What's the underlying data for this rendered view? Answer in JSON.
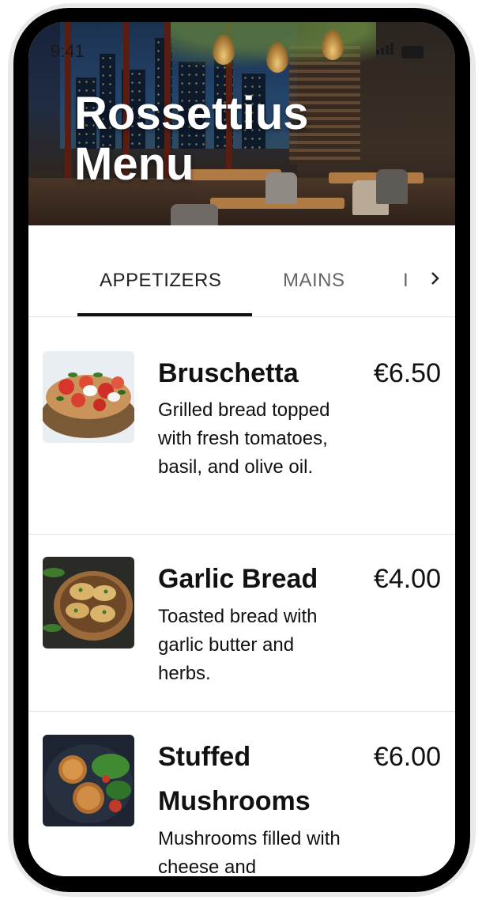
{
  "status_bar": {
    "time": "9:41"
  },
  "hero": {
    "title_line1": "Rossettius",
    "title_line2": "Menu"
  },
  "tabs": [
    {
      "label": "APPETIZERS",
      "active": true
    },
    {
      "label": "MAINS",
      "active": false
    },
    {
      "label": "I",
      "active": false
    }
  ],
  "tabs_more_icon": "chevron-right-icon",
  "menu": [
    {
      "name": "Bruschetta",
      "price": "€6.50",
      "description": "Grilled bread topped with fresh tomatoes, basil, and olive oil."
    },
    {
      "name": "Garlic Bread",
      "price": "€4.00",
      "description": "Toasted bread with garlic butter and herbs."
    },
    {
      "name_line1": "Stuffed",
      "name_line2": "Mushrooms",
      "price": "€6.00",
      "description": "Mushrooms filled with cheese and"
    }
  ]
}
